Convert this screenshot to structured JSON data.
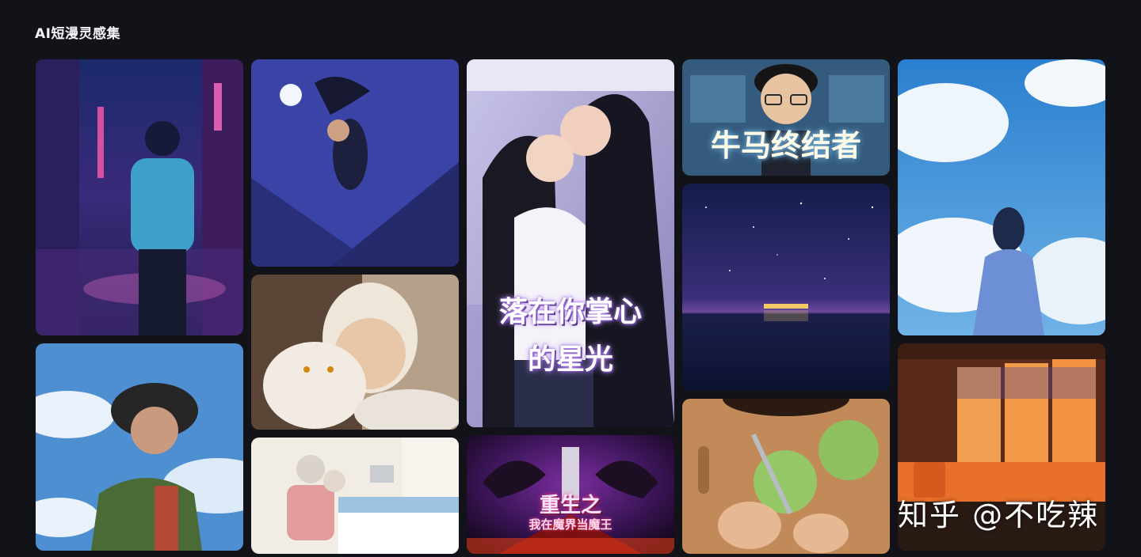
{
  "page": {
    "title": "AI短漫灵感集"
  },
  "cards": {
    "c1": {
      "name": "neon-alley-boy"
    },
    "c2": {
      "name": "ninja-night-rooftops"
    },
    "c3": {
      "name": "office-romance-poster",
      "title_line1": "落在你掌心",
      "title_line2": "的星光"
    },
    "c4": {
      "name": "office-chibi-poster",
      "title": "牛马终结者"
    },
    "c5": {
      "name": "starry-sea-night"
    },
    "c6": {
      "name": "girl-in-cloud-sky"
    },
    "c7": {
      "name": "windswept-girl"
    },
    "c8": {
      "name": "boy-with-white-cat"
    },
    "c9": {
      "name": "elderly-couple-hospital"
    },
    "c10": {
      "name": "demon-king-poster",
      "title_line1": "重生之",
      "title_line2": "我在魔界当魔王"
    },
    "c11": {
      "name": "chopping-cabbage"
    },
    "c12": {
      "name": "sunset-train-interior"
    }
  },
  "watermark": "知乎 @不吃辣",
  "colors": {
    "background": "#121318",
    "title": "#f2f2f5"
  }
}
